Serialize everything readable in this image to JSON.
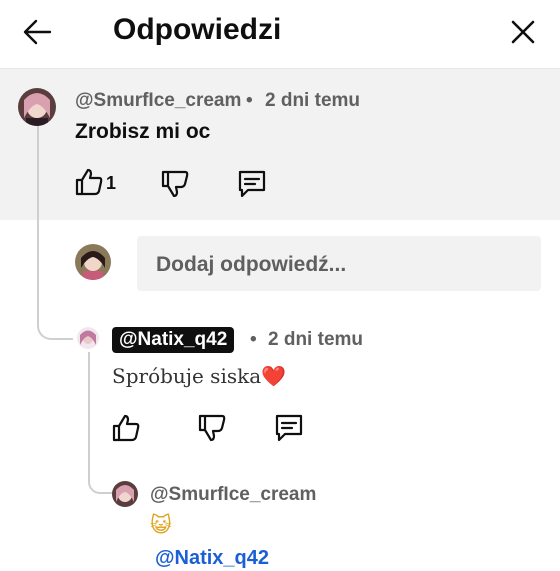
{
  "header": {
    "title": "Odpowiedzi",
    "back_icon": "arrow-left-icon",
    "close_icon": "close-icon"
  },
  "main_comment": {
    "author": "@SmurfIce_cream",
    "separator": "•",
    "time": "2 dni temu",
    "text": "Zrobisz mi oc",
    "like_count": "1"
  },
  "reply_box": {
    "placeholder": "Dodaj odpowiedź..."
  },
  "replies": [
    {
      "author": "@Natix_q42",
      "separator": "•",
      "time": "2 dni temu",
      "text": "Spróbuje siska",
      "emoji": "❤️",
      "author_highlighted": true
    },
    {
      "author": "@SmurfIce_cream",
      "emoji": "😺",
      "mention": "@Natix_q42"
    }
  ],
  "colors": {
    "accent_link": "#1a5fd6",
    "main_comment_bg": "#f2f2f2",
    "text_secondary": "#606060"
  }
}
